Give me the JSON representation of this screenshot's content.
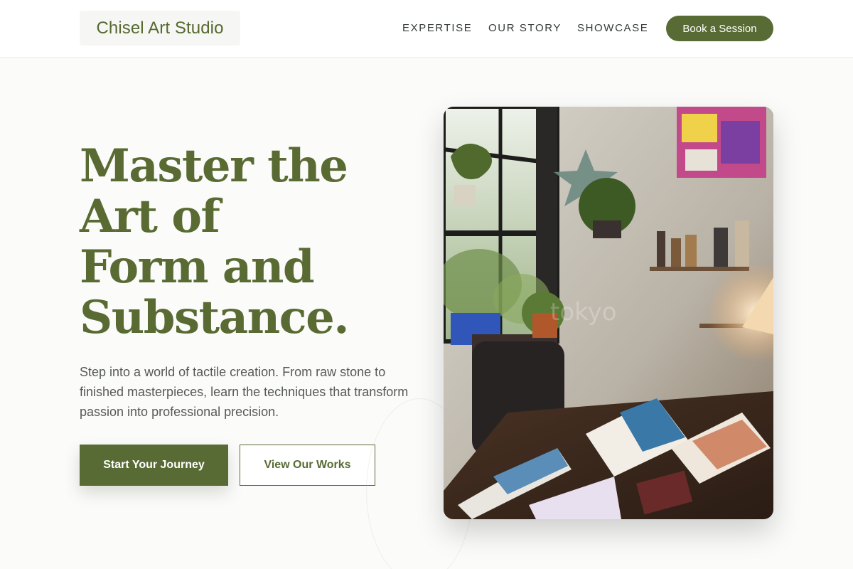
{
  "header": {
    "logo": "Chisel Art Studio",
    "nav": [
      {
        "label": "EXPERTISE"
      },
      {
        "label": "OUR STORY"
      },
      {
        "label": "SHOWCASE"
      }
    ],
    "cta_label": "Book a Session"
  },
  "hero": {
    "title_lines": [
      "Master the",
      "Art of",
      "Form and",
      "Substance."
    ],
    "subtitle": "Step into a world of tactile creation. From raw stone to finished masterpieces, learn the techniques that transform passion into professional precision.",
    "primary_button": "Start Your Journey",
    "secondary_button": "View Our Works"
  },
  "colors": {
    "brand": "#586b34",
    "background": "#fbfbfa",
    "text": "#565a58"
  }
}
